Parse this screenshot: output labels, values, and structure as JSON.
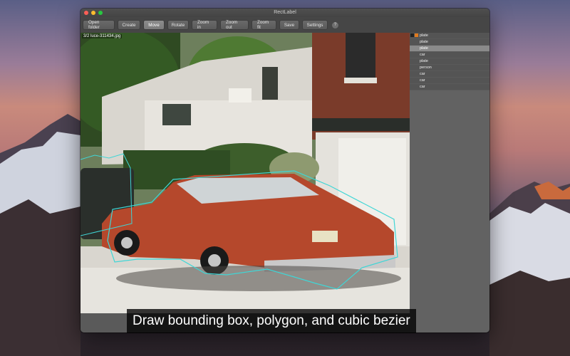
{
  "window": {
    "title": "RectLabel"
  },
  "toolbar": {
    "buttons": [
      {
        "label": "Open folder",
        "active": false
      },
      {
        "label": "Create",
        "active": false
      },
      {
        "label": "Move",
        "active": true
      },
      {
        "label": "Rotate",
        "active": false
      },
      {
        "label": "Zoom in",
        "active": false
      },
      {
        "label": "Zoom out",
        "active": false
      },
      {
        "label": "Zoom fit",
        "active": false
      },
      {
        "label": "Save",
        "active": false
      },
      {
        "label": "Settings",
        "active": false
      }
    ],
    "help_label": "?"
  },
  "image": {
    "filename": "3/2 luce-311434.jpg"
  },
  "labels": {
    "items": [
      "plate",
      "plate",
      "plate",
      "car",
      "plate",
      "person",
      "car",
      "car",
      "car"
    ],
    "selected_index": 2,
    "colors": {
      "label_swatch": "#e07b1f",
      "dark_swatch": "#222222"
    }
  },
  "caption": {
    "text": "Draw bounding box, polygon, and cubic bezier"
  },
  "colors": {
    "polygon_outline": "#3fd6d6",
    "car_body": "#b5482c"
  }
}
